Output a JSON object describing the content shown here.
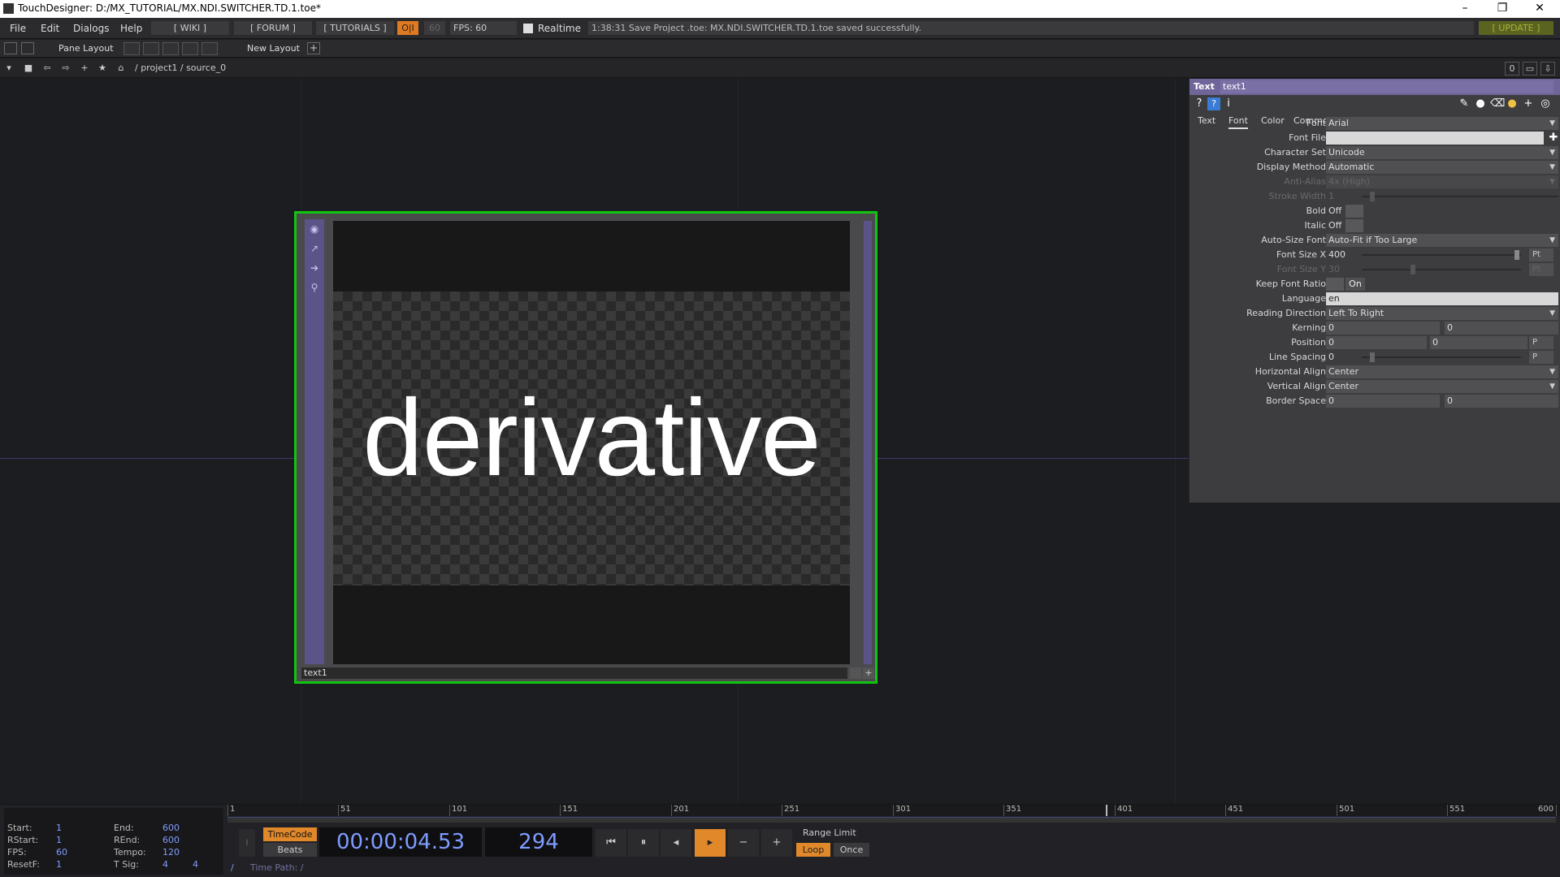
{
  "window": {
    "title": "TouchDesigner: D:/MX_TUTORIAL/MX.NDI.SWITCHER.TD.1.toe*"
  },
  "menu": {
    "file": "File",
    "edit": "Edit",
    "dialogs": "Dialogs",
    "help": "Help",
    "wiki": "[ WIKI ]",
    "forum": "[ FORUM ]",
    "tutorials": "[ TUTORIALS ]",
    "perf": "O|I",
    "fps_cap": "60",
    "fps": "FPS:  60",
    "realtime": "Realtime",
    "status": "1:38:31 Save Project .toe: MX.NDI.SWITCHER.TD.1.toe saved successfully.",
    "update": "[ UPDATE ]"
  },
  "toolbar": {
    "pane_layout": "Pane Layout",
    "new_layout": "New Layout",
    "plus": "+"
  },
  "path": {
    "crumbs": "/  project1  /  source_0",
    "right_value": "0"
  },
  "node": {
    "name": "text1",
    "render_text": "derivative"
  },
  "params": {
    "op_type": "Text",
    "op_name": "text1",
    "tabs": [
      "Text",
      "Font",
      "Color",
      "Common"
    ],
    "active_tab": "Font",
    "rows": {
      "font": {
        "label": "Font",
        "value": "Arial"
      },
      "font_file": {
        "label": "Font File",
        "value": ""
      },
      "char_set": {
        "label": "Character Set",
        "value": "Unicode"
      },
      "display_method": {
        "label": "Display Method",
        "value": "Automatic"
      },
      "anti_alias": {
        "label": "Anti-Alias",
        "value": "4x (High)"
      },
      "stroke_width": {
        "label": "Stroke Width",
        "value": "1"
      },
      "bold": {
        "label": "Bold",
        "value": "Off"
      },
      "italic": {
        "label": "Italic",
        "value": "Off"
      },
      "auto_size": {
        "label": "Auto-Size Font",
        "value": "Auto-Fit if Too Large"
      },
      "font_size_x": {
        "label": "Font Size X",
        "value": "400",
        "unit": "Pt"
      },
      "font_size_y": {
        "label": "Font Size Y",
        "value": "30",
        "unit": "Pt"
      },
      "keep_ratio": {
        "label": "Keep Font Ratio",
        "value": "On"
      },
      "language": {
        "label": "Language",
        "value": "en"
      },
      "reading_dir": {
        "label": "Reading Direction",
        "value": "Left To Right"
      },
      "kerning": {
        "label": "Kerning",
        "v1": "0",
        "v2": "0"
      },
      "position": {
        "label": "Position",
        "v1": "0",
        "v2": "0",
        "unit": "P"
      },
      "line_spacing": {
        "label": "Line Spacing",
        "value": "0",
        "unit": "P"
      },
      "h_align": {
        "label": "Horizontal Align",
        "value": "Center"
      },
      "v_align": {
        "label": "Vertical Align",
        "value": "Center"
      },
      "border_space": {
        "label": "Border Space",
        "v1": "0",
        "v2": "0"
      }
    }
  },
  "timeline": {
    "start_lbl": "Start:",
    "start": "1",
    "rstart_lbl": "RStart:",
    "rstart": "1",
    "fps_lbl": "FPS:",
    "fps": "60",
    "resetf_lbl": "ResetF:",
    "resetf": "1",
    "end_lbl": "End:",
    "end": "600",
    "rend_lbl": "REnd:",
    "rend": "600",
    "tempo_lbl": "Tempo:",
    "tempo": "120",
    "tsig_lbl": "T Sig:",
    "tsig_a": "4",
    "tsig_b": "4",
    "ticks": [
      "1",
      "51",
      "101",
      "151",
      "201",
      "251",
      "301",
      "351",
      "401",
      "451",
      "501",
      "551",
      "600"
    ],
    "timecode_btn": "TimeCode",
    "beats_btn": "Beats",
    "timecode": "00:00:04.53",
    "frame": "294",
    "range_limit": "Range Limit",
    "loop": "Loop",
    "once": "Once",
    "time_path": "Time Path: /"
  },
  "colors": {
    "accent": "#f0a030",
    "node_border": "#12c412",
    "param_header": "#6f6598",
    "timecode": "#7f9cff"
  }
}
